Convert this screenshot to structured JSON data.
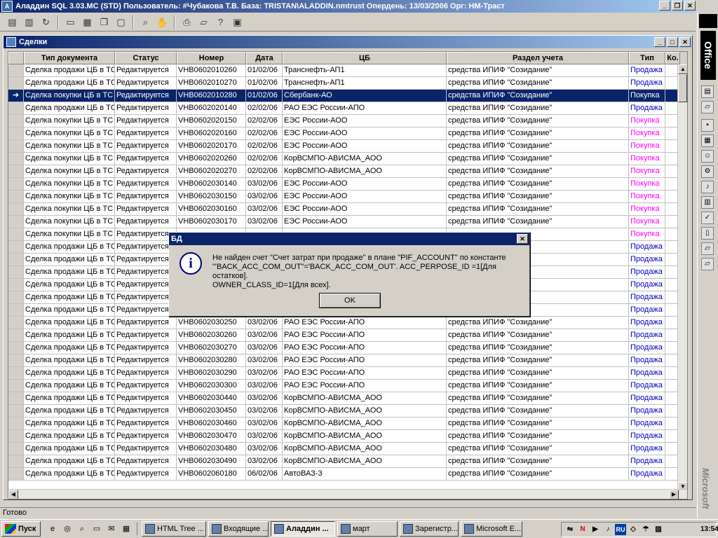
{
  "app": {
    "title": "Аладдин SQL 3.03.MC (STD)  Пользователь: #Чубакова Т.В. База: TRISTAN\\ALADDIN.nmtrust Опердень: 13/03/2006 Орг: НМ-Траст",
    "min": "_",
    "max": "❐",
    "close": "✕"
  },
  "mdi": {
    "title": "Сделки",
    "min": "_",
    "max": "□",
    "close": "✕"
  },
  "grid": {
    "headers": [
      "",
      "Тип документа",
      "Статус",
      "Номер",
      "Дата",
      "ЦБ",
      "Раздел учета",
      "Тип",
      "Ко."
    ],
    "rows": [
      {
        "marker": "",
        "type": "Сделка продажи ЦБ в ТС",
        "status": "Редактируется",
        "number": "VHB0602010260",
        "date": "01/02/06",
        "cb": "Транснефть-АП1",
        "section": "средства ИПИФ \"Созидание\"",
        "kind": "Продажа",
        "k": "sale"
      },
      {
        "marker": "",
        "type": "Сделка продажи ЦБ в ТС",
        "status": "Редактируется",
        "number": "VHB0602010270",
        "date": "01/02/06",
        "cb": "Транснефть-АП1",
        "section": "средства ИПИФ \"Созидание\"",
        "kind": "Продажа",
        "k": "sale"
      },
      {
        "marker": "➔",
        "type": "Сделка покупки ЦБ в ТС",
        "status": "Редактируется",
        "number": "VHB0602010280",
        "date": "01/02/06",
        "cb": "Сбербанк-АО",
        "section": "средства ИПИФ \"Созидание\"",
        "kind": "Покупка",
        "k": "buy",
        "selected": true
      },
      {
        "marker": "",
        "type": "Сделка продажи ЦБ в ТС",
        "status": "Редактируется",
        "number": "VHB0602020140",
        "date": "02/02/06",
        "cb": "РАО ЕЭС России-АПО",
        "section": "средства ИПИФ \"Созидание\"",
        "kind": "Продажа",
        "k": "sale"
      },
      {
        "marker": "",
        "type": "Сделка покупки ЦБ в ТС",
        "status": "Редактируется",
        "number": "VHB0602020150",
        "date": "02/02/06",
        "cb": "ЕЭС России-АОО",
        "section": "средства ИПИФ \"Созидание\"",
        "kind": "Покупка",
        "k": "buy"
      },
      {
        "marker": "",
        "type": "Сделка покупки ЦБ в ТС",
        "status": "Редактируется",
        "number": "VHB0602020160",
        "date": "02/02/06",
        "cb": "ЕЭС России-АОО",
        "section": "средства ИПИФ \"Созидание\"",
        "kind": "Покупка",
        "k": "buy"
      },
      {
        "marker": "",
        "type": "Сделка покупки ЦБ в ТС",
        "status": "Редактируется",
        "number": "VHB0602020170",
        "date": "02/02/06",
        "cb": "ЕЭС России-АОО",
        "section": "средства ИПИФ \"Созидание\"",
        "kind": "Покупка",
        "k": "buy"
      },
      {
        "marker": "",
        "type": "Сделка покупки ЦБ в ТС",
        "status": "Редактируется",
        "number": "VHB0602020260",
        "date": "02/02/06",
        "cb": "КорВСМПО-АВИСМА_АОО",
        "section": "средства ИПИФ \"Созидание\"",
        "kind": "Покупка",
        "k": "buy"
      },
      {
        "marker": "",
        "type": "Сделка покупки ЦБ в ТС",
        "status": "Редактируется",
        "number": "VHB0602020270",
        "date": "02/02/06",
        "cb": "КорВСМПО-АВИСМА_АОО",
        "section": "средства ИПИФ \"Созидание\"",
        "kind": "Покупка",
        "k": "buy"
      },
      {
        "marker": "",
        "type": "Сделка покупки ЦБ в ТС",
        "status": "Редактируется",
        "number": "VHB0602030140",
        "date": "03/02/06",
        "cb": "ЕЭС России-АОО",
        "section": "средства ИПИФ \"Созидание\"",
        "kind": "Покупка",
        "k": "buy"
      },
      {
        "marker": "",
        "type": "Сделка покупки ЦБ в ТС",
        "status": "Редактируется",
        "number": "VHB0602030150",
        "date": "03/02/06",
        "cb": "ЕЭС России-АОО",
        "section": "средства ИПИФ \"Созидание\"",
        "kind": "Покупка",
        "k": "buy"
      },
      {
        "marker": "",
        "type": "Сделка покупки ЦБ в ТС",
        "status": "Редактируется",
        "number": "VHB0602030160",
        "date": "03/02/06",
        "cb": "ЕЭС России-АОО",
        "section": "средства ИПИФ \"Созидание\"",
        "kind": "Покупка",
        "k": "buy"
      },
      {
        "marker": "",
        "type": "Сделка покупки ЦБ в ТС",
        "status": "Редактируется",
        "number": "VHB0602030170",
        "date": "03/02/06",
        "cb": "ЕЭС России-АОО",
        "section": "средства ИПИФ \"Созидание\"",
        "kind": "Покупка",
        "k": "buy"
      },
      {
        "marker": "",
        "type": "Сделка покупки ЦБ в ТС",
        "status": "Редактируется",
        "number": "",
        "date": "",
        "cb": "",
        "section": "",
        "kind": "Покупка",
        "k": "buy"
      },
      {
        "marker": "",
        "type": "Сделка продажи ЦБ в ТС",
        "status": "Редактируется",
        "number": "",
        "date": "",
        "cb": "",
        "section": "",
        "kind": "Продажа",
        "k": "sale"
      },
      {
        "marker": "",
        "type": "Сделка продажи ЦБ в ТС",
        "status": "Редактируется",
        "number": "",
        "date": "",
        "cb": "",
        "section": "",
        "kind": "Продажа",
        "k": "sale"
      },
      {
        "marker": "",
        "type": "Сделка продажи ЦБ в ТС",
        "status": "Редактируется",
        "number": "",
        "date": "",
        "cb": "",
        "section": "",
        "kind": "Продажа",
        "k": "sale"
      },
      {
        "marker": "",
        "type": "Сделка продажи ЦБ в ТС",
        "status": "Редактируется",
        "number": "",
        "date": "",
        "cb": "",
        "section": "",
        "kind": "Продажа",
        "k": "sale"
      },
      {
        "marker": "",
        "type": "Сделка продажи ЦБ в ТС",
        "status": "Редактируется",
        "number": "",
        "date": "",
        "cb": "",
        "section": "",
        "kind": "Продажа",
        "k": "sale"
      },
      {
        "marker": "",
        "type": "Сделка продажи ЦБ в ТС",
        "status": "Редактируется",
        "number": "",
        "date": "",
        "cb": "",
        "section": "",
        "kind": "Продажа",
        "k": "sale"
      },
      {
        "marker": "",
        "type": "Сделка продажи ЦБ в ТС",
        "status": "Редактируется",
        "number": "VHB0602030250",
        "date": "03/02/06",
        "cb": "РАО ЕЭС России-АПО",
        "section": "средства ИПИФ \"Созидание\"",
        "kind": "Продажа",
        "k": "sale"
      },
      {
        "marker": "",
        "type": "Сделка продажи ЦБ в ТС",
        "status": "Редактируется",
        "number": "VHB0602030260",
        "date": "03/02/06",
        "cb": "РАО ЕЭС России-АПО",
        "section": "средства ИПИФ \"Созидание\"",
        "kind": "Продажа",
        "k": "sale"
      },
      {
        "marker": "",
        "type": "Сделка продажи ЦБ в ТС",
        "status": "Редактируется",
        "number": "VHB0602030270",
        "date": "03/02/06",
        "cb": "РАО ЕЭС России-АПО",
        "section": "средства ИПИФ \"Созидание\"",
        "kind": "Продажа",
        "k": "sale"
      },
      {
        "marker": "",
        "type": "Сделка продажи ЦБ в ТС",
        "status": "Редактируется",
        "number": "VHB0602030280",
        "date": "03/02/06",
        "cb": "РАО ЕЭС России-АПО",
        "section": "средства ИПИФ \"Созидание\"",
        "kind": "Продажа",
        "k": "sale"
      },
      {
        "marker": "",
        "type": "Сделка продажи ЦБ в ТС",
        "status": "Редактируется",
        "number": "VHB0602030290",
        "date": "03/02/06",
        "cb": "РАО ЕЭС России-АПО",
        "section": "средства ИПИФ \"Созидание\"",
        "kind": "Продажа",
        "k": "sale"
      },
      {
        "marker": "",
        "type": "Сделка продажи ЦБ в ТС",
        "status": "Редактируется",
        "number": "VHB0602030300",
        "date": "03/02/06",
        "cb": "РАО ЕЭС России-АПО",
        "section": "средства ИПИФ \"Созидание\"",
        "kind": "Продажа",
        "k": "sale"
      },
      {
        "marker": "",
        "type": "Сделка продажи ЦБ в ТС",
        "status": "Редактируется",
        "number": "VHB0602030440",
        "date": "03/02/06",
        "cb": "КорВСМПО-АВИСМА_АОО",
        "section": "средства ИПИФ \"Созидание\"",
        "kind": "Продажа",
        "k": "sale"
      },
      {
        "marker": "",
        "type": "Сделка продажи ЦБ в ТС",
        "status": "Редактируется",
        "number": "VHB0602030450",
        "date": "03/02/06",
        "cb": "КорВСМПО-АВИСМА_АОО",
        "section": "средства ИПИФ \"Созидание\"",
        "kind": "Продажа",
        "k": "sale"
      },
      {
        "marker": "",
        "type": "Сделка продажи ЦБ в ТС",
        "status": "Редактируется",
        "number": "VHB0602030460",
        "date": "03/02/06",
        "cb": "КорВСМПО-АВИСМА_АОО",
        "section": "средства ИПИФ \"Созидание\"",
        "kind": "Продажа",
        "k": "sale"
      },
      {
        "marker": "",
        "type": "Сделка продажи ЦБ в ТС",
        "status": "Редактируется",
        "number": "VHB0602030470",
        "date": "03/02/06",
        "cb": "КорВСМПО-АВИСМА_АОО",
        "section": "средства ИПИФ \"Созидание\"",
        "kind": "Продажа",
        "k": "sale"
      },
      {
        "marker": "",
        "type": "Сделка продажи ЦБ в ТС",
        "status": "Редактируется",
        "number": "VHB0602030480",
        "date": "03/02/06",
        "cb": "КорВСМПО-АВИСМА_АОО",
        "section": "средства ИПИФ \"Созидание\"",
        "kind": "Продажа",
        "k": "sale"
      },
      {
        "marker": "",
        "type": "Сделка продажи ЦБ в ТС",
        "status": "Редактируется",
        "number": "VHB0602030490",
        "date": "03/02/06",
        "cb": "КорВСМПО-АВИСМА_АОО",
        "section": "средства ИПИФ \"Созидание\"",
        "kind": "Продажа",
        "k": "sale"
      },
      {
        "marker": "",
        "type": "Сделка продажи ЦБ в ТС",
        "status": "Редактируется",
        "number": "VHB0602060180",
        "date": "06/02/06",
        "cb": "АвтоВАЗ-3",
        "section": "средства ИПИФ \"Созидание\"",
        "kind": "Продажа",
        "k": "sale"
      }
    ]
  },
  "dialog": {
    "title": "БД",
    "close": "✕",
    "icon": "i",
    "line1": "Не найден счет \"Счет затрат при продаже\" в плане \"PIF_ACCOUNT\" по константе",
    "line2": "\"'BACK_ACC_COM_OUT\"='BACK_ACC_COM_OUT'. ACC_PERPOSE_ID =1[Для остатков].",
    "line3": "OWNER_CLASS_ID=1[Для всех].",
    "ok": "OK"
  },
  "statusbar": {
    "text": "Готово"
  },
  "officebar": {
    "label": "Office",
    "vendor": "Microsoft"
  },
  "taskbar": {
    "start": "Пуск",
    "tasks": [
      "HTML Tree ...",
      "Входящие ...",
      "Аладдин ...",
      "март",
      "Зарегистр...",
      "Microsoft E..."
    ],
    "active_index": 2,
    "clock": "13:54",
    "tray": [
      "N",
      "RU"
    ]
  },
  "colors": {
    "title_bar": "#0a246a",
    "sale": "#0000c0",
    "buy": "#ff00ff",
    "selection": "#0a246a"
  }
}
